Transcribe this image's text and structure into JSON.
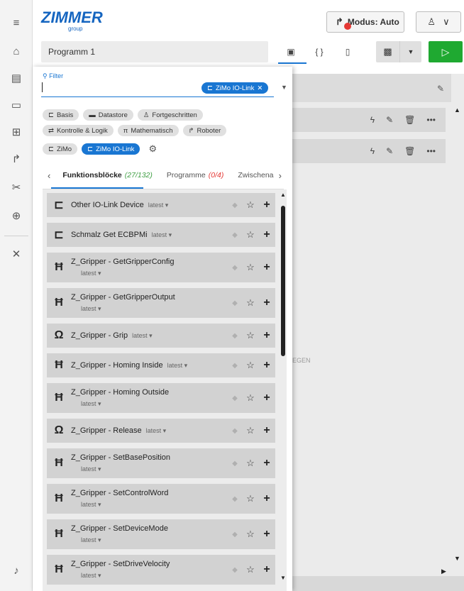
{
  "header": {
    "logo": "ZIMMER",
    "logo_sub": "group",
    "mode_label": "Modus: Auto",
    "user_caret": "∨"
  },
  "toolbar": {
    "program_name": "Programm 1"
  },
  "filter": {
    "label": "Filter",
    "active_chip": "ZiMo IO-Link"
  },
  "categories": {
    "row1": [
      "Basis",
      "Datastore",
      "Fortgeschritten"
    ],
    "row2": [
      "Kontrolle & Logik",
      "Mathematisch",
      "Roboter"
    ],
    "row3": [
      "ZiMo",
      "ZiMo IO-Link"
    ]
  },
  "tabs": {
    "t1_label": "Funktionsblöcke",
    "t1_count": "(27/132)",
    "t2_label": "Programme",
    "t2_count": "(0/4)",
    "t3_label": "Zwischena"
  },
  "blocks": [
    {
      "name": "Other IO-Link Device",
      "version": "latest"
    },
    {
      "name": "Schmalz Get ECBPMi",
      "version": "latest"
    },
    {
      "name": "Z_Gripper - GetGripperConfig",
      "version": "latest"
    },
    {
      "name": "Z_Gripper - GetGripperOutput",
      "version": "latest"
    },
    {
      "name": "Z_Gripper - Grip",
      "version": "latest"
    },
    {
      "name": "Z_Gripper - Homing Inside",
      "version": "latest"
    },
    {
      "name": "Z_Gripper - Homing Outside",
      "version": "latest"
    },
    {
      "name": "Z_Gripper - Release",
      "version": "latest"
    },
    {
      "name": "Z_Gripper - SetBasePosition",
      "version": "latest"
    },
    {
      "name": "Z_Gripper - SetControlWord",
      "version": "latest"
    },
    {
      "name": "Z_Gripper - SetDeviceMode",
      "version": "latest"
    },
    {
      "name": "Z_Gripper - SetDriveVelocity",
      "version": "latest"
    }
  ],
  "editor": {
    "partial_text": "EGEN"
  },
  "colors": {
    "accent": "#1976d2",
    "run": "#1fa931",
    "mode_dot": "#e53935"
  }
}
